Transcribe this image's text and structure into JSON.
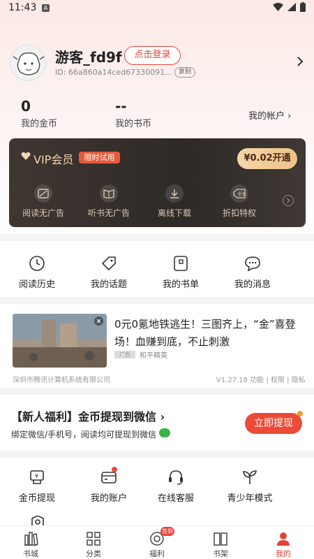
{
  "status_bar": {
    "time": "11:43",
    "notification_icon": "A"
  },
  "profile": {
    "username": "游客_fd9f",
    "login_label": "点击登录",
    "user_id": "ID: 66a860a14ced67330091...",
    "copy_label": "复制"
  },
  "stats": {
    "coins_value": "0",
    "coins_label": "我的金币",
    "book_coins_value": "--",
    "book_coins_label": "我的书币",
    "account_link": "我的帐户 ›"
  },
  "vip": {
    "title": "VIP会员",
    "trial_badge": "限时试用",
    "open_button": "¥0.02开通",
    "features": [
      {
        "label": "阅读无广告",
        "icon": "ad-free-book-icon"
      },
      {
        "label": "听书无广告",
        "icon": "ad-free-audio-icon"
      },
      {
        "label": "离线下载",
        "icon": "download-icon"
      },
      {
        "label": "折扣特权",
        "icon": "discount-tag-icon",
        "icon_text": "折扣"
      }
    ]
  },
  "quick_links": [
    {
      "label": "阅读历史",
      "icon": "clock-icon"
    },
    {
      "label": "我的话题",
      "icon": "tag-icon"
    },
    {
      "label": "我的书单",
      "icon": "booklist-icon"
    },
    {
      "label": "我的消息",
      "icon": "message-icon"
    }
  ],
  "ad": {
    "title": "0元0氪地铁逃生！三图齐上，“金”喜登场！血赚到底，不止刺激",
    "tag": "广告",
    "game": "和平精英",
    "company": "深圳市腾讯计算机系统有限公司",
    "meta": "V1.27.18  功能 | 权限 | 隐私",
    "close": "×"
  },
  "welfare": {
    "title": "【新人福利】金币提现到微信 ›",
    "subtitle": "绑定微信/手机号，阅读均可提现到微信",
    "button": "立即提现"
  },
  "services": [
    {
      "label": "金币提现",
      "icon": "coin-withdraw-icon"
    },
    {
      "label": "我的账户",
      "icon": "wallet-icon"
    },
    {
      "label": "在线客服",
      "icon": "headset-icon"
    },
    {
      "label": "青少年模式",
      "icon": "sprout-icon"
    }
  ],
  "tabbar": {
    "items": [
      {
        "label": "书城",
        "icon": "bookstore-icon"
      },
      {
        "label": "分类",
        "icon": "category-icon"
      },
      {
        "label": "福利",
        "icon": "welfare-icon"
      },
      {
        "label": "书架",
        "icon": "bookshelf-icon"
      },
      {
        "label": "我的",
        "icon": "profile-icon"
      }
    ],
    "welfare_badge": "签到",
    "active_color": "#e0453a"
  },
  "colors": {
    "accent": "#e0453a",
    "vip_gold": "#f2d6b3",
    "wechat_green": "#3bb34a"
  }
}
